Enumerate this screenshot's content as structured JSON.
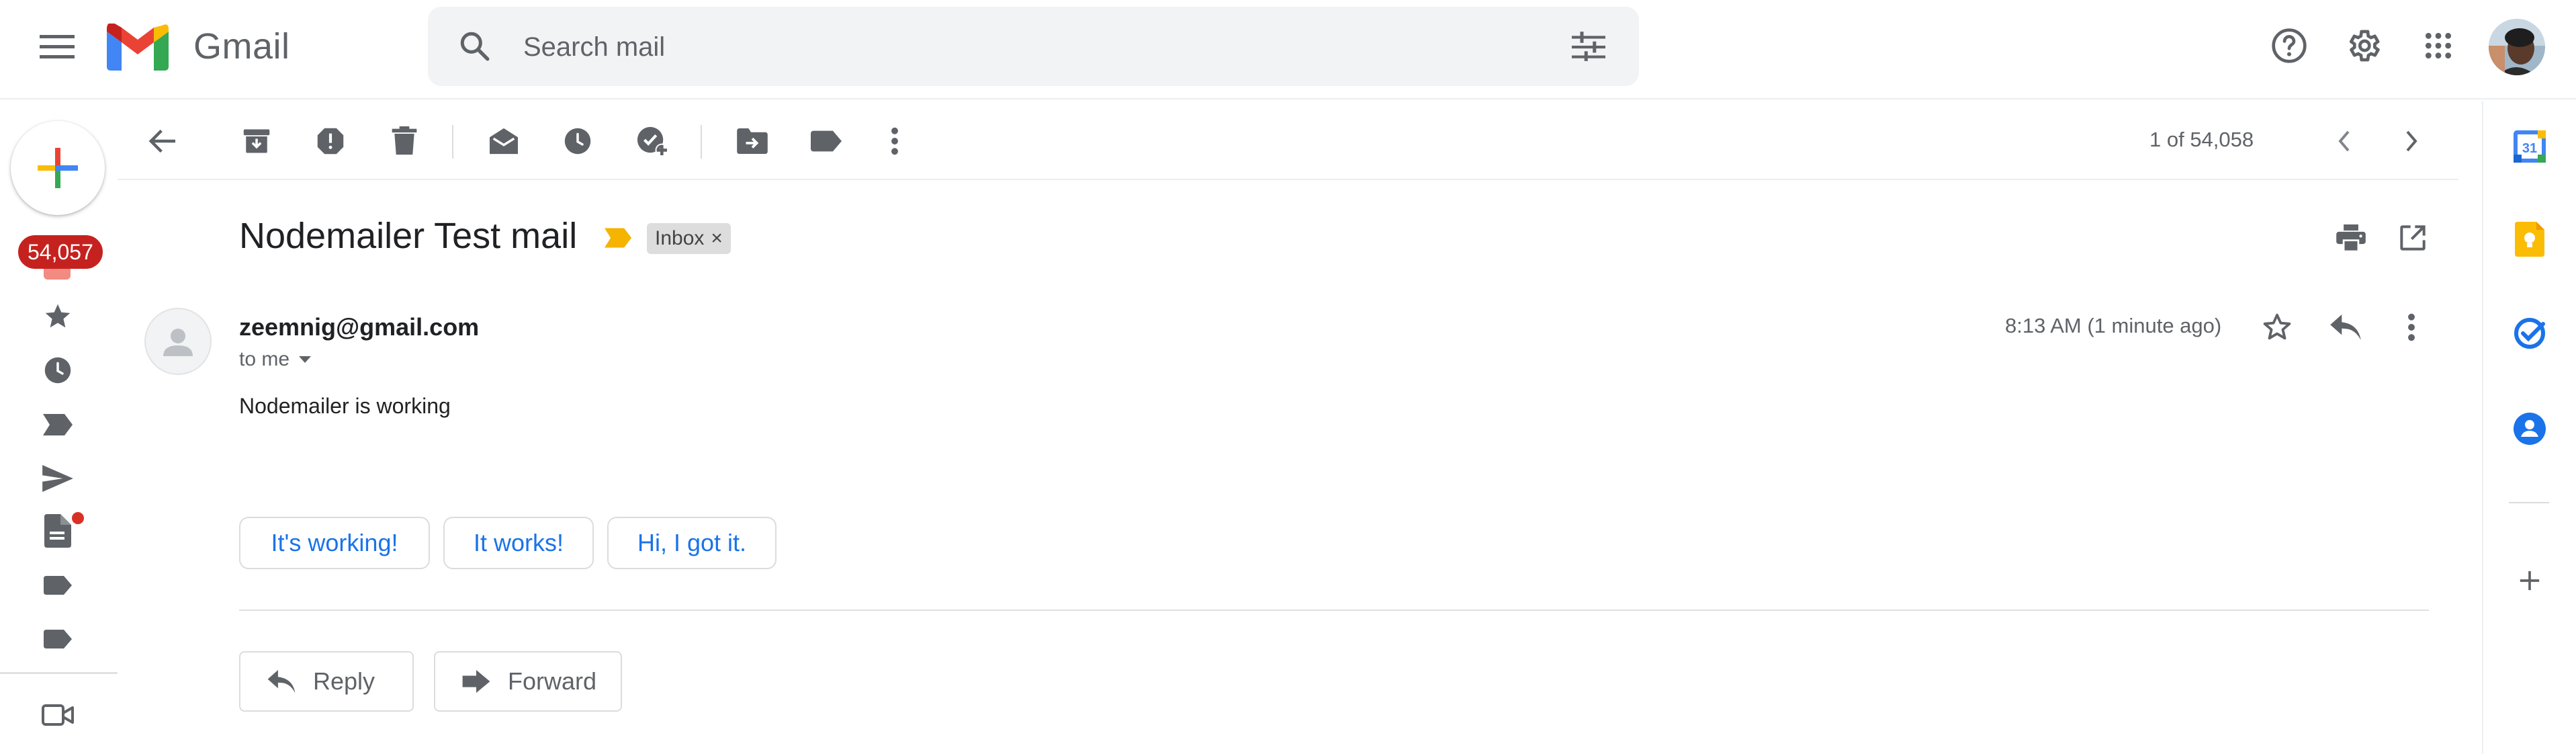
{
  "header": {
    "brand": "Gmail",
    "search_placeholder": "Search mail",
    "icons": [
      "menu-icon",
      "gmail-logo",
      "search-icon",
      "search-options-icon",
      "help-icon",
      "settings-icon",
      "apps-icon",
      "account-avatar"
    ]
  },
  "left_rail": {
    "compose_icon": "compose-plus-icon",
    "unread_badge": "54,057",
    "items": [
      "inbox-icon",
      "starred-icon",
      "snoozed-icon",
      "important-icon",
      "sent-icon",
      "drafts-icon",
      "label-icon",
      "label-icon",
      "meet-video-icon"
    ]
  },
  "toolbar": {
    "icons": [
      "back-arrow-icon",
      "archive-icon",
      "report-spam-icon",
      "delete-icon",
      "mark-unread-icon",
      "snooze-icon",
      "add-to-tasks-icon",
      "move-to-icon",
      "labels-icon",
      "more-vert-icon"
    ],
    "pager_text": "1 of 54,058"
  },
  "message": {
    "subject": "Nodemailer Test mail",
    "label_chip": "Inbox",
    "label_close": "×",
    "sender": "zeemnig@gmail.com",
    "to": "to me",
    "time": "8:13 AM (1 minute ago)",
    "body": "Nodemailer is working",
    "smart_replies": [
      "It's working!",
      "It works!",
      "Hi, I got it."
    ],
    "reply_label": "Reply",
    "forward_label": "Forward"
  },
  "right_panel": {
    "apps": [
      "calendar-icon",
      "keep-icon",
      "tasks-icon",
      "contacts-icon",
      "add-app-icon"
    ],
    "calendar_day": "31"
  },
  "colors": {
    "accent_blue": "#1a73e8",
    "badge_red": "#c5221f",
    "important_yellow": "#f4b400",
    "icon_gray": "#5f6368"
  }
}
